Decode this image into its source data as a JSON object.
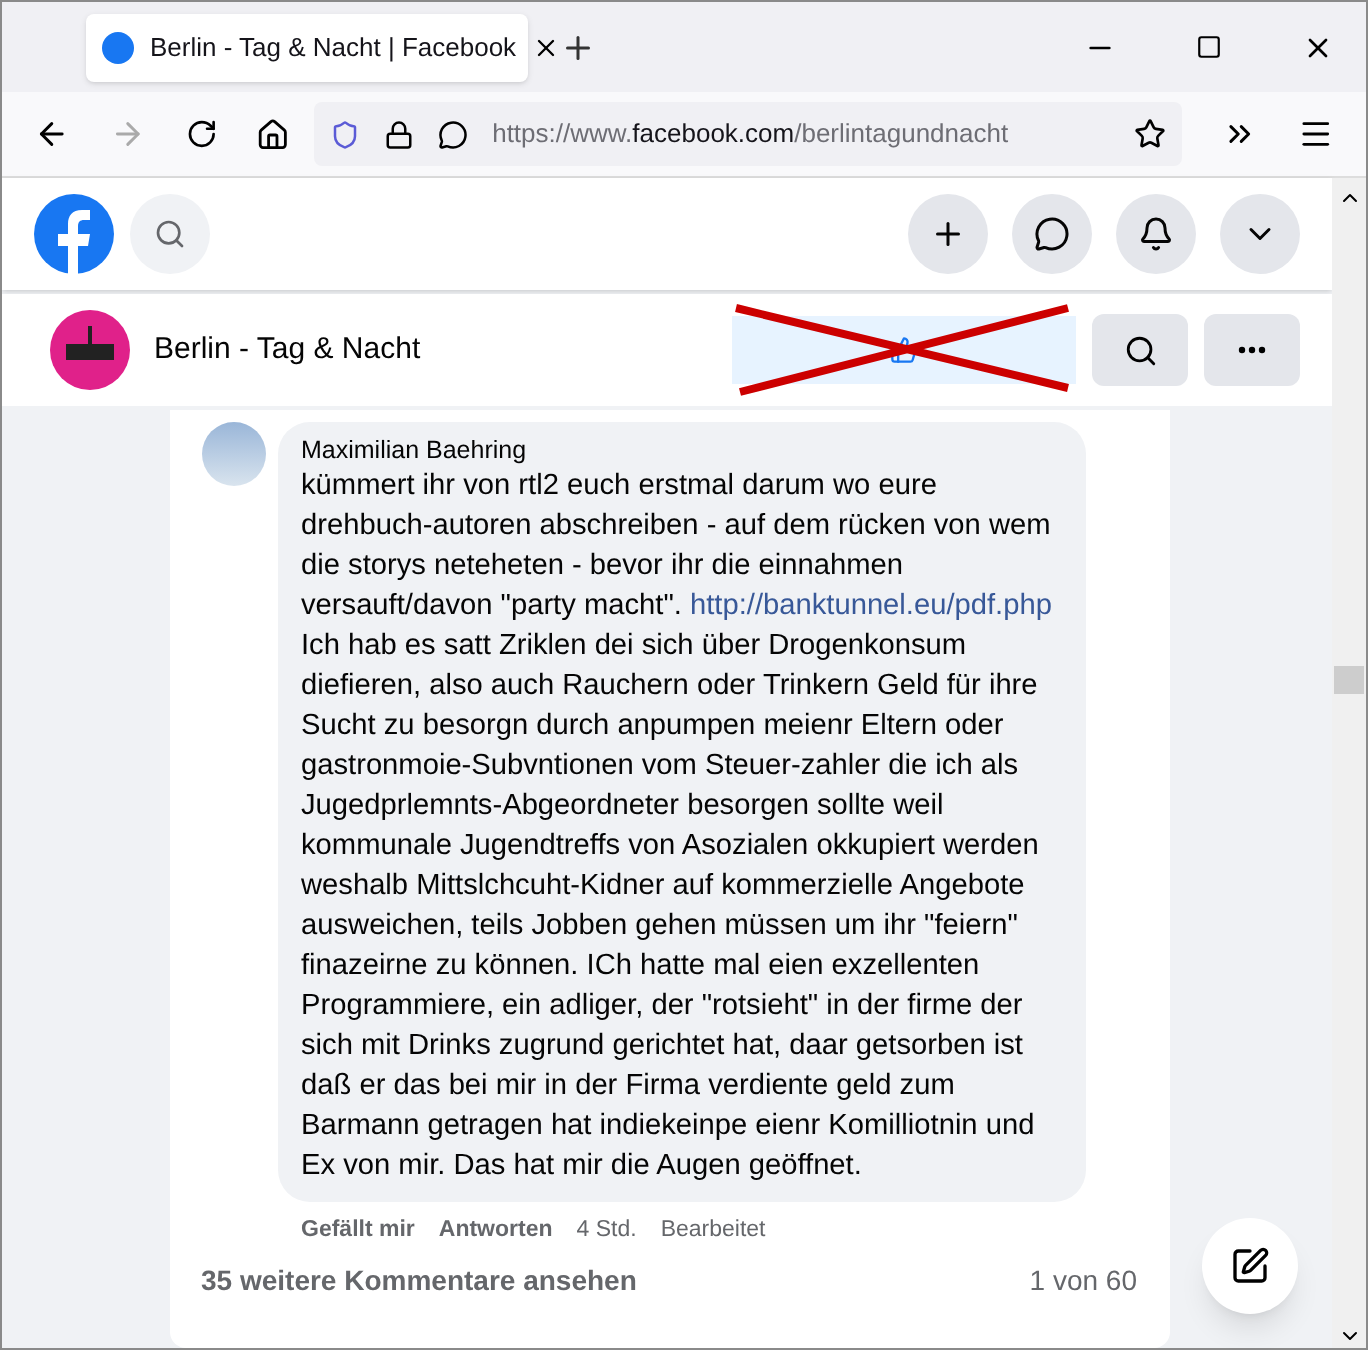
{
  "browser": {
    "tab": {
      "title": "Berlin - Tag & Nacht | Facebook",
      "selected": true
    },
    "url": {
      "prefix": "https://www.",
      "domain": "facebook.com",
      "path": "/berlintagundnacht"
    }
  },
  "page_header": {
    "name": "Berlin - Tag & Nacht"
  },
  "comment": {
    "author": "Maximilian Baehring",
    "text_before": "kümmert ihr von rtl2 euch erstmal darum wo eure drehbuch-autoren abschreiben - auf dem rücken von wem die storys neteheten - bevor ihr die einnahmen versauft/davon \"party macht\". ",
    "link": "http://banktunnel.eu/pdf.php",
    "text_after": " Ich hab es satt Zriklen dei sich über Drogenkonsum diefieren, also auch Rauchern oder Trinkern Geld für ihre Sucht zu besorgn durch anpumpen meienr Eltern oder gastronmoie-Subvntionen vom Steuer-zahler die ich als Jugedprlemnts-Abgeordneter besorgen sollte weil kommunale Jugendtreffs von Asozialen okkupiert werden weshalb Mittslchcuht-Kidner auf kommerzielle Angebote ausweichen, teils Jobben gehen müssen um ihr \"feiern\" finazeirne zu können. ICh hatte mal eien exzellenten Programmiere, ein adliger, der \"rotsieht\" in der firme der sich mit Drinks zugrund gerichtet hat, daar getsorben ist daß er das bei mir in der Firma verdiente geld zum Barmann getragen hat indiekeinpe eienr Komilliotnin und Ex von mir. Das hat mir die Augen geöffnet.",
    "actions": [
      "Gefällt mir",
      "Antworten"
    ],
    "time": "4 Std.",
    "edited": "Bearbeitet"
  },
  "more_comments": "35 weitere Kommentare ansehen",
  "count": "1 von 60"
}
